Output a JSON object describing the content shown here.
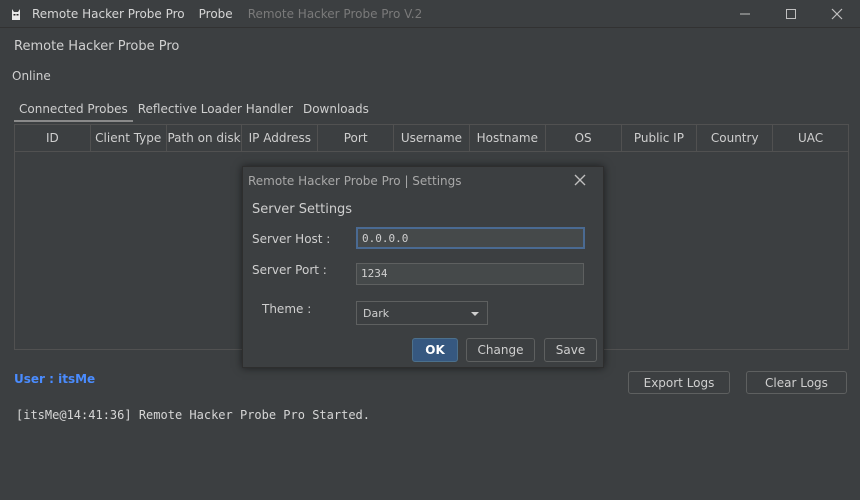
{
  "titlebar": {
    "app_name": "Remote Hacker Probe Pro",
    "menu_probe": "Probe",
    "window_title": "Remote Hacker Probe Pro V.2"
  },
  "header": {
    "title": "Remote Hacker Probe Pro",
    "status": "Online"
  },
  "tabs": [
    {
      "label": "Connected Probes",
      "active": true
    },
    {
      "label": "Reflective Loader Handler",
      "active": false
    },
    {
      "label": "Downloads",
      "active": false
    }
  ],
  "table": {
    "columns": [
      "ID",
      "Client Type",
      "Path on disk",
      "IP Address",
      "Port",
      "Username",
      "Hostname",
      "OS",
      "Public IP",
      "Country",
      "UAC"
    ]
  },
  "footer": {
    "user_label": "User : itsMe",
    "export_logs": "Export Logs",
    "clear_logs": "Clear Logs",
    "log_line": "[itsMe@14:41:36] Remote Hacker Probe Pro Started."
  },
  "dialog": {
    "title": "Remote Hacker Probe Pro | Settings",
    "section": "Server Settings",
    "host_label": "Server Host :",
    "host_value": "0.0.0.0",
    "port_label": "Server Port :",
    "port_value": "1234",
    "theme_label": "Theme :",
    "theme_value": "Dark",
    "ok": "OK",
    "change": "Change",
    "save": "Save"
  },
  "colors": {
    "background": "#3c3f41",
    "user_accent": "#4a8cff",
    "primary_button": "#365880"
  },
  "icons": {
    "app": "hacker-icon",
    "minimize": "minimize-icon",
    "maximize": "maximize-icon",
    "close": "close-icon",
    "dropdown": "chevron-down-icon"
  }
}
